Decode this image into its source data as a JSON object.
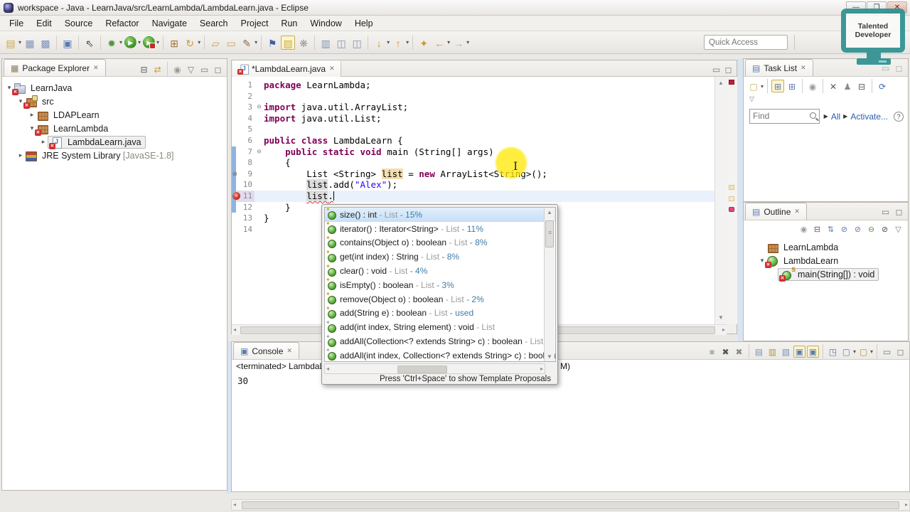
{
  "window": {
    "title": "workspace - Java - LearnJava/src/LearnLambda/LambdaLearn.java - Eclipse",
    "minimize": "—",
    "restore": "❐",
    "close": "✕"
  },
  "menu": [
    "File",
    "Edit",
    "Source",
    "Refactor",
    "Navigate",
    "Search",
    "Project",
    "Run",
    "Window",
    "Help"
  ],
  "toolbar": {
    "quick_access_placeholder": "Quick Access",
    "main": [
      {
        "n": "new-wizard-icon",
        "g": "▤",
        "c": "#caa84a",
        "d": 1
      },
      {
        "n": "save-icon",
        "g": "▦",
        "c": "#7d93b8"
      },
      {
        "n": "save-all-icon",
        "g": "▩",
        "c": "#7d93b8"
      },
      {
        "n": "open-console-icon",
        "g": "▣",
        "c": "#5a7cae",
        "s": 1
      },
      {
        "n": "pointer-icon",
        "g": "⇖",
        "c": "#4a4a4a",
        "s": 1
      },
      {
        "n": "debug-icon",
        "g": "✹",
        "c": "#4f9a3c",
        "d": 1,
        "s": 1
      },
      {
        "n": "run-icon",
        "g": "▶",
        "c": "#ffffff",
        "cls": "run",
        "d": 1
      },
      {
        "n": "coverage-icon",
        "g": "▶",
        "c": "#ffffff",
        "cls": "cov",
        "d": 1
      },
      {
        "n": "new-java-project-icon",
        "g": "⊞",
        "c": "#a4743c",
        "s": 1
      },
      {
        "n": "update-icon",
        "g": "↻",
        "c": "#c79a2e",
        "d": 1
      },
      {
        "n": "open-type-icon",
        "g": "▱",
        "c": "#d0a23e",
        "s": 1
      },
      {
        "n": "open-resource-icon",
        "g": "▭",
        "c": "#d0a23e"
      },
      {
        "n": "annotate-icon",
        "g": "✎",
        "c": "#8a6a4a",
        "d": 1
      },
      {
        "n": "search-icon",
        "g": "⚑",
        "c": "#3d5fa8",
        "s": 1
      },
      {
        "n": "mark-occurrences-icon",
        "g": "▨",
        "c": "#c8b040",
        "p": 1
      },
      {
        "n": "external-tools-icon",
        "g": "❋",
        "c": "#9a9a9a"
      },
      {
        "n": "next-edit-icon",
        "g": "▥",
        "c": "#7d93b8",
        "s": 1
      },
      {
        "n": "editor-window-0-icon",
        "g": "◫",
        "c": "#7d93b8"
      },
      {
        "n": "editor-window-1-icon",
        "g": "◫",
        "c": "#7d93b8"
      },
      {
        "n": "next-annotation-icon",
        "g": "↓",
        "c": "#c79a2e",
        "d": 1,
        "s": 1
      },
      {
        "n": "prev-annotation-icon",
        "g": "↑",
        "c": "#c79a2e",
        "d": 1
      },
      {
        "n": "last-edit-location-icon",
        "g": "✦",
        "c": "#c79a2e",
        "s": 1
      },
      {
        "n": "back-icon",
        "g": "←",
        "c": "#c79a2e",
        "d": 1
      },
      {
        "n": "forward-icon",
        "g": "→",
        "c": "#b4b0aa",
        "d": 1
      }
    ]
  },
  "watermark": {
    "line1": "Talented",
    "line2": "Developer"
  },
  "package_explorer": {
    "title": "Package Explorer",
    "header_icons": [
      {
        "n": "collapse-all-icon",
        "g": "⊟",
        "c": "#5a5a5a"
      },
      {
        "n": "link-with-editor-icon",
        "g": "⇄",
        "c": "#c79a2e"
      },
      {
        "n": "focus-icon",
        "g": "◉",
        "c": "#9a9a9a",
        "s": 1
      },
      {
        "n": "view-menu-icon",
        "g": "▽",
        "c": "#7a7a7a"
      },
      {
        "n": "minimize-icon",
        "g": "▭",
        "c": "#7a7a7a"
      },
      {
        "n": "maximize-icon",
        "g": "◻",
        "c": "#7a7a7a"
      }
    ],
    "tree": [
      {
        "label": "LearnJava",
        "lvl": 0,
        "icon": "project",
        "arrow": "open",
        "err": 1
      },
      {
        "label": "src",
        "lvl": 1,
        "icon": "src",
        "arrow": "open",
        "err": 1
      },
      {
        "label": "LDAPLearn",
        "lvl": 2,
        "icon": "pkg",
        "arrow": "closed"
      },
      {
        "label": "LearnLambda",
        "lvl": 2,
        "icon": "pkg",
        "arrow": "open",
        "err": 1
      },
      {
        "label": "LambdaLearn.java",
        "lvl": 3,
        "icon": "jfile",
        "arrow": "closed",
        "err": 1,
        "sel": 1
      },
      {
        "label": "JRE System Library",
        "sub": " [JavaSE-1.8]",
        "lvl": 1,
        "icon": "lib",
        "arrow": "closed"
      }
    ]
  },
  "editor": {
    "tab": "*LambdaLearn.java",
    "lines": [
      {
        "n": 1,
        "segs": [
          [
            "k",
            "package"
          ],
          [
            "p",
            " LearnLambda;"
          ]
        ]
      },
      {
        "n": 2,
        "segs": []
      },
      {
        "n": 3,
        "fold": "⊖",
        "segs": [
          [
            "k",
            "import"
          ],
          [
            "p",
            " java.util.ArrayList;"
          ]
        ]
      },
      {
        "n": 4,
        "segs": [
          [
            "k",
            "import"
          ],
          [
            "p",
            " java.util.List;"
          ]
        ]
      },
      {
        "n": 5,
        "segs": []
      },
      {
        "n": 6,
        "segs": [
          [
            "k",
            "public"
          ],
          [
            "p",
            " "
          ],
          [
            "k",
            "class"
          ],
          [
            "p",
            " LambdaLearn {"
          ]
        ]
      },
      {
        "n": 7,
        "fold": "⊖",
        "diff": 1,
        "segs": [
          [
            "p",
            "    "
          ],
          [
            "k",
            "public"
          ],
          [
            "p",
            " "
          ],
          [
            "k",
            "static"
          ],
          [
            "p",
            " "
          ],
          [
            "k",
            "void"
          ],
          [
            "p",
            " main (String[] args)"
          ]
        ]
      },
      {
        "n": 8,
        "diff": 1,
        "segs": [
          [
            "p",
            "    {"
          ]
        ]
      },
      {
        "n": 9,
        "diff": 1,
        "mark": "warn",
        "segs": [
          [
            "p",
            "        List <String> "
          ],
          [
            "ot",
            "list"
          ],
          [
            "p",
            " = "
          ],
          [
            "k",
            "new"
          ],
          [
            "p",
            " ArrayList<String>();"
          ]
        ]
      },
      {
        "n": 10,
        "diff": 1,
        "segs": [
          [
            "p",
            "        "
          ],
          [
            "og",
            "list"
          ],
          [
            "p",
            ".add("
          ],
          [
            "s",
            "\"Alex\""
          ],
          [
            "p",
            ");"
          ]
        ]
      },
      {
        "n": 11,
        "diff": 1,
        "mark": "error",
        "current": 1,
        "caret": 1,
        "segs": [
          [
            "p",
            "        "
          ],
          [
            "oge",
            "list"
          ],
          [
            "pe",
            "."
          ]
        ]
      },
      {
        "n": 12,
        "diff": 1,
        "segs": [
          [
            "p",
            "    }"
          ]
        ]
      },
      {
        "n": 13,
        "segs": [
          [
            "p",
            "}"
          ]
        ]
      },
      {
        "n": 14,
        "segs": []
      }
    ]
  },
  "completion": {
    "items": [
      {
        "icon": "a",
        "main": "size() : int",
        "rest": " - List",
        "pct": " - 15%",
        "sel": 1
      },
      {
        "icon": "a",
        "main": "iterator() : Iterator<String>",
        "rest": " - List",
        "pct": " - 11%"
      },
      {
        "icon": "a",
        "main": "contains(Object o) : boolean",
        "rest": " - List",
        "pct": " - 8%"
      },
      {
        "icon": "a",
        "main": "get(int index) : String",
        "rest": " - List",
        "pct": " - 8%"
      },
      {
        "icon": "a",
        "main": "clear() : void",
        "rest": " - List",
        "pct": " - 4%"
      },
      {
        "icon": "a",
        "main": "isEmpty() : boolean",
        "rest": " - List",
        "pct": " - 3%"
      },
      {
        "icon": "a",
        "main": "remove(Object o) : boolean",
        "rest": " - List",
        "pct": " - 2%"
      },
      {
        "icon": "a",
        "main": "add(String e) : boolean",
        "rest": " - List",
        "pct": " - used"
      },
      {
        "icon": "m",
        "main": "add(int index, String element) : void",
        "rest": " - List",
        "pct": ""
      },
      {
        "icon": "m",
        "main": "addAll(Collection<? extends String> c) : boolean",
        "rest": " - List",
        "pct": ""
      },
      {
        "icon": "m",
        "main": "addAll(int index, Collection<? extends String> c) : boolean",
        "rest": "",
        "pct": ""
      }
    ],
    "hint": "Press 'Ctrl+Space' to show Template Proposals"
  },
  "task_list": {
    "title": "Task List",
    "toolbar": [
      {
        "n": "new-task-icon",
        "g": "▢",
        "c": "#caa84a",
        "d": 1
      },
      {
        "n": "categorized-view-icon",
        "g": "⊞",
        "c": "#5a7cae",
        "p": 1,
        "s": 1
      },
      {
        "n": "scheduled-view-icon",
        "g": "⊞",
        "c": "#5a7cae"
      },
      {
        "n": "focus-workweek-icon",
        "g": "◉",
        "c": "#9a9a9a",
        "s": 1
      },
      {
        "n": "hide-completed-icon",
        "g": "✕",
        "c": "#555555",
        "s": 1
      },
      {
        "n": "filter-person-icon",
        "g": "♟",
        "c": "#8a8a8a"
      },
      {
        "n": "collapse-all-icon",
        "g": "⊟",
        "c": "#5a5a5a"
      },
      {
        "n": "synchronize-icon",
        "g": "⟳",
        "c": "#3d6fae",
        "s": 1
      }
    ],
    "find_placeholder": "Find",
    "link_all": "All",
    "link_activate": "Activate...",
    "header_icons": [
      {
        "n": "minimize-icon",
        "g": "▭",
        "c": "#b0aca6"
      },
      {
        "n": "maximize-icon",
        "g": "◻",
        "c": "#b0aca6"
      }
    ]
  },
  "outline": {
    "title": "Outline",
    "toolbar": [
      {
        "n": "focus-icon",
        "g": "◉",
        "c": "#9a9a9a"
      },
      {
        "n": "collapse-all-icon",
        "g": "⊟",
        "c": "#5a5a5a"
      },
      {
        "n": "sort-icon",
        "g": "⇅",
        "c": "#5a7cae"
      },
      {
        "n": "hide-fields-icon",
        "g": "⊘",
        "c": "#5a7cae"
      },
      {
        "n": "hide-static-members-icon",
        "g": "⊘",
        "c": "#8a6aae"
      },
      {
        "n": "hide-non-public-icon",
        "g": "⊖",
        "c": "#4f9a3c"
      },
      {
        "n": "hide-local-types-icon",
        "g": "⊘",
        "c": "#4a4a4a"
      },
      {
        "n": "view-menu-icon",
        "g": "▽",
        "c": "#7a7a7a"
      }
    ],
    "header_icons": [
      {
        "n": "minimize-icon",
        "g": "▭",
        "c": "#7a7a7a"
      },
      {
        "n": "maximize-icon",
        "g": "◻",
        "c": "#7a7a7a"
      }
    ],
    "tree": [
      {
        "label": "LearnLambda",
        "icon": "pkg",
        "lvl": 1
      },
      {
        "label": "LambdaLearn",
        "icon": "cls",
        "lvl": 1,
        "arrow": "open",
        "err": 1
      },
      {
        "label": "main(String[]) : void",
        "icon": "method",
        "static": 1,
        "lvl": 2,
        "err": 1,
        "sel": 1
      }
    ]
  },
  "console": {
    "title": "Console",
    "toolbar": [
      {
        "n": "terminate-icon",
        "g": "■",
        "c": "#b0b0b0"
      },
      {
        "n": "remove-launch-icon",
        "g": "✖",
        "c": "#555555"
      },
      {
        "n": "remove-all-launches-icon",
        "g": "✖",
        "c": "#8a8a8a"
      },
      {
        "n": "clear-console-icon",
        "g": "▤",
        "c": "#7d93b8",
        "s": 1
      },
      {
        "n": "scroll-lock-icon",
        "g": "▥",
        "c": "#b8962e"
      },
      {
        "n": "word-wrap-icon",
        "g": "▧",
        "c": "#7d93b8"
      },
      {
        "n": "show-stdout-icon",
        "g": "▣",
        "c": "#5a7cae",
        "p": 1
      },
      {
        "n": "show-stderr-icon",
        "g": "▣",
        "c": "#5a7cae",
        "p": 1
      },
      {
        "n": "pin-console-icon",
        "g": "◳",
        "c": "#5a7cae",
        "s": 1
      },
      {
        "n": "display-selected-console-icon",
        "g": "▢",
        "c": "#5a7cae",
        "d": 1
      },
      {
        "n": "open-console-icon",
        "g": "▢",
        "c": "#b8962e",
        "d": 1
      },
      {
        "n": "minimize-icon",
        "g": "▭",
        "c": "#7a7a7a",
        "s": 1
      },
      {
        "n": "maximize-icon",
        "g": "◻",
        "c": "#7a7a7a"
      }
    ],
    "status_left": "<terminated> LambdaLe",
    "status_right": "M)",
    "output": "30"
  }
}
